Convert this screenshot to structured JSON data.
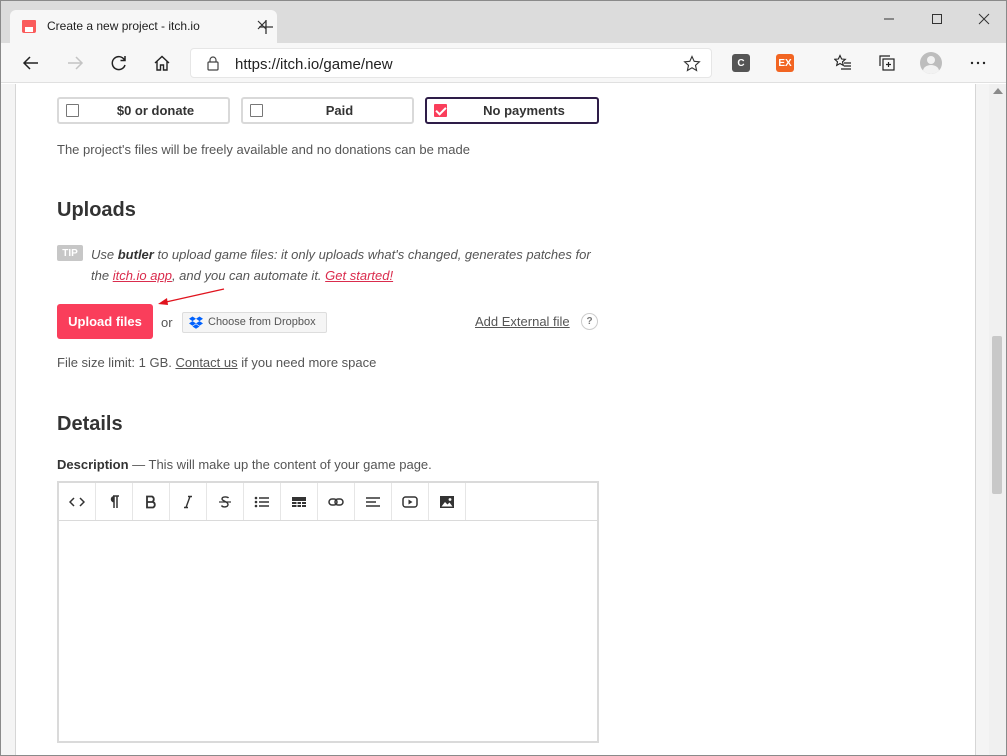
{
  "browser": {
    "tab_title": "Create a new project - itch.io",
    "url": "https://itch.io/game/new",
    "extensions": [
      {
        "label": "C",
        "color": "#555555"
      },
      {
        "label": "EX",
        "color": "#f26522"
      }
    ]
  },
  "pricing": {
    "options": [
      {
        "label": "$0 or donate",
        "selected": false
      },
      {
        "label": "Paid",
        "selected": false
      },
      {
        "label": "No payments",
        "selected": true
      }
    ],
    "help": "The project's files will be freely available and no donations can be made"
  },
  "uploads": {
    "heading": "Uploads",
    "tip_badge": "TIP",
    "tip_use": "Use ",
    "tip_butler": "butler",
    "tip_mid": " to upload game files: it only uploads what's changed, generates patches for the ",
    "tip_app_link": "itch.io app",
    "tip_after": ", and you can automate it. ",
    "tip_start_link": "Get started!",
    "upload_button": "Upload files",
    "or": "or",
    "dropbox_button": "Choose from Dropbox",
    "external_link": "Add External file",
    "help_icon": "?",
    "limit_prefix": "File size limit: 1 GB. ",
    "limit_link": "Contact us",
    "limit_suffix": " if you need more space"
  },
  "details": {
    "heading": "Details",
    "desc_label": "Description",
    "desc_help": " — This will make up the content of your game page.",
    "toolbar": [
      "code-icon",
      "paragraph-icon",
      "bold-icon",
      "italic-icon",
      "strikethrough-icon",
      "bulleted-list-icon",
      "table-icon",
      "link-icon",
      "align-icon",
      "video-icon",
      "image-icon"
    ]
  }
}
